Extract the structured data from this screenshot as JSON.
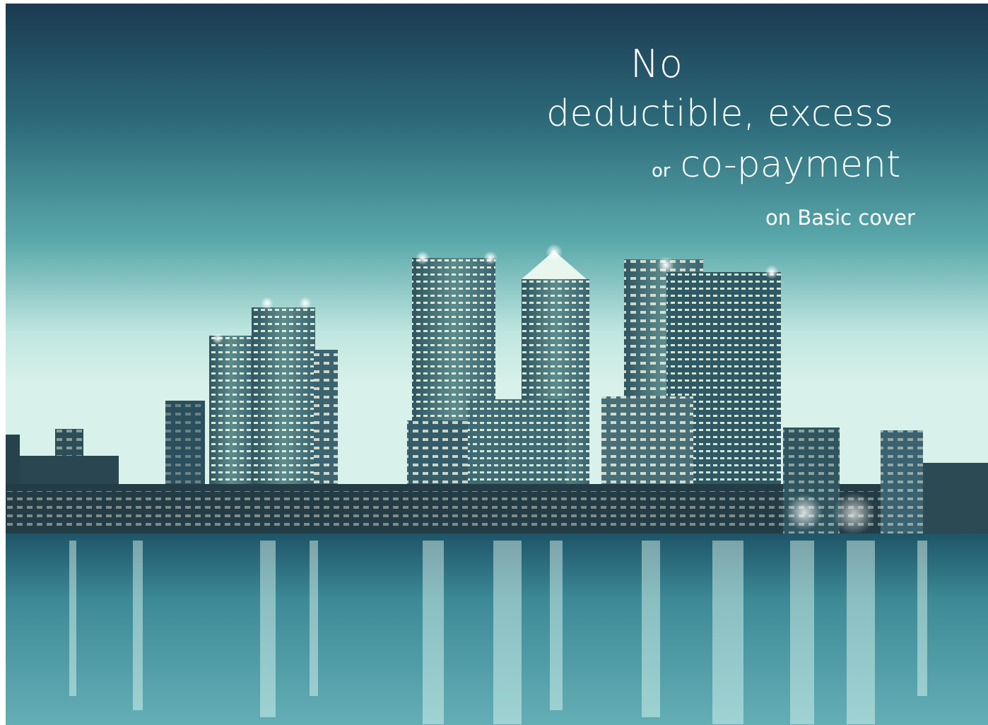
{
  "headline": {
    "line1": "No",
    "line2": "deductible, excess",
    "line3_prefix": "or",
    "line3_main": "co-payment",
    "subline": "on Basic cover"
  },
  "image": {
    "subject": "city-skyline-at-night",
    "tint": "#4a9ea6"
  }
}
